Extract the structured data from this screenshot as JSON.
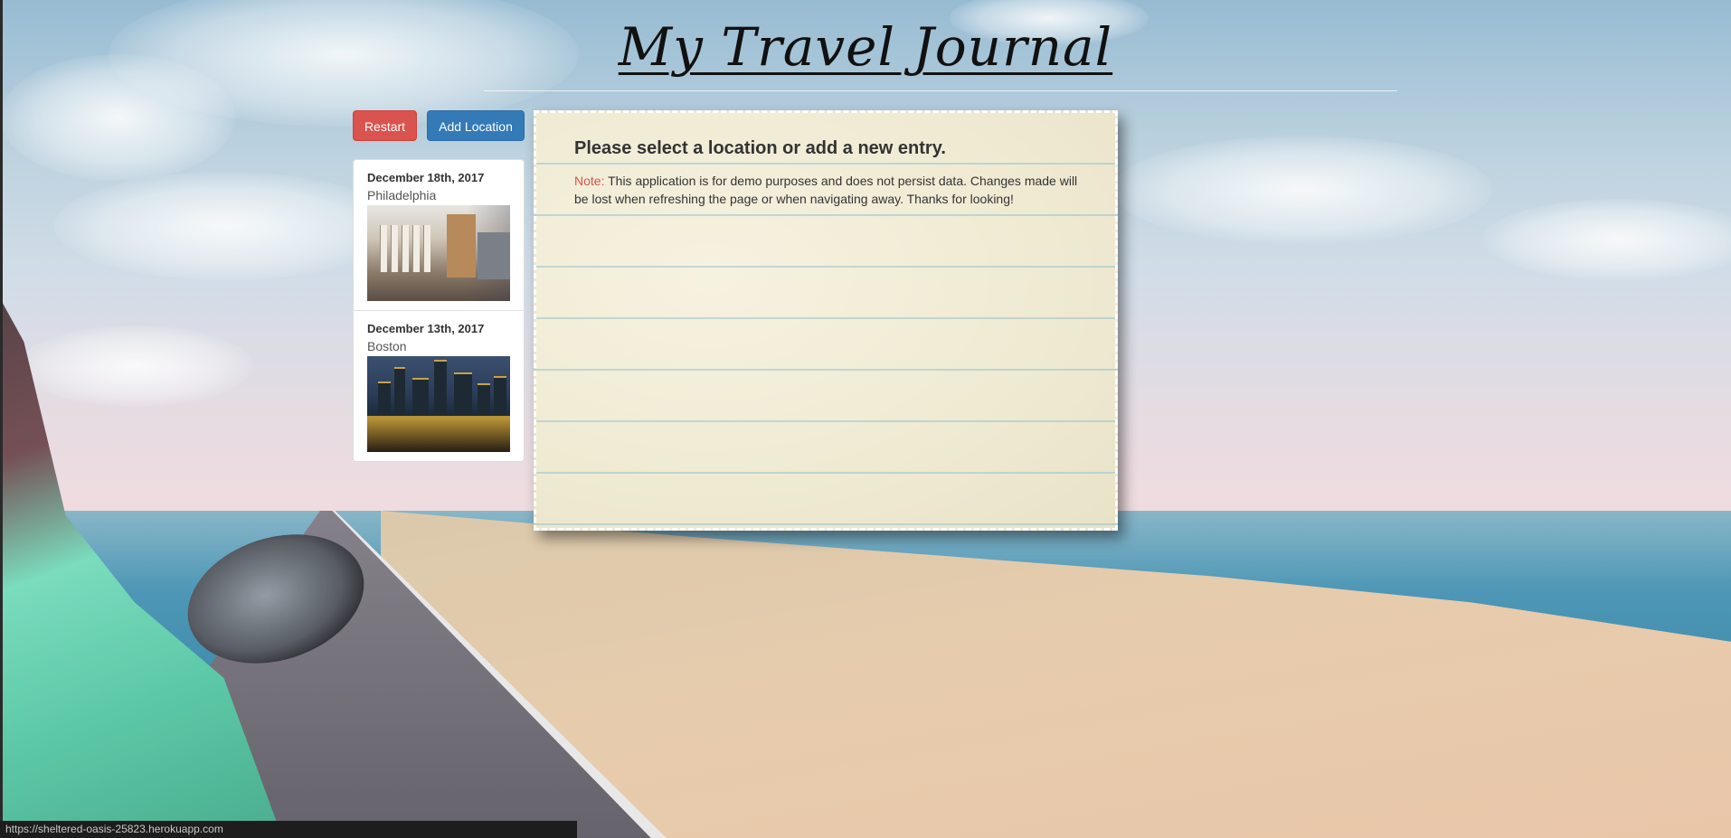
{
  "header": {
    "title": "My Travel Journal"
  },
  "toolbar": {
    "restart_label": "Restart",
    "add_location_label": "Add Location"
  },
  "entries": [
    {
      "date": "December 18th, 2017",
      "city": "Philadelphia",
      "image": "philadelphia-photo"
    },
    {
      "date": "December 13th, 2017",
      "city": "Boston",
      "image": "boston-photo"
    }
  ],
  "panel": {
    "heading": "Please select a location or add a new entry.",
    "note_label": "Note:",
    "note_text": " This application is for demo purposes and does not persist data. Changes made will be lost when refreshing the page or when navigating away. Thanks for looking!"
  },
  "status_bar": {
    "url": "https://sheltered-oasis-25823.herokuapp.com"
  },
  "colors": {
    "restart": "#d9534f",
    "add_location": "#337ab7",
    "note_label": "#d9534f"
  }
}
